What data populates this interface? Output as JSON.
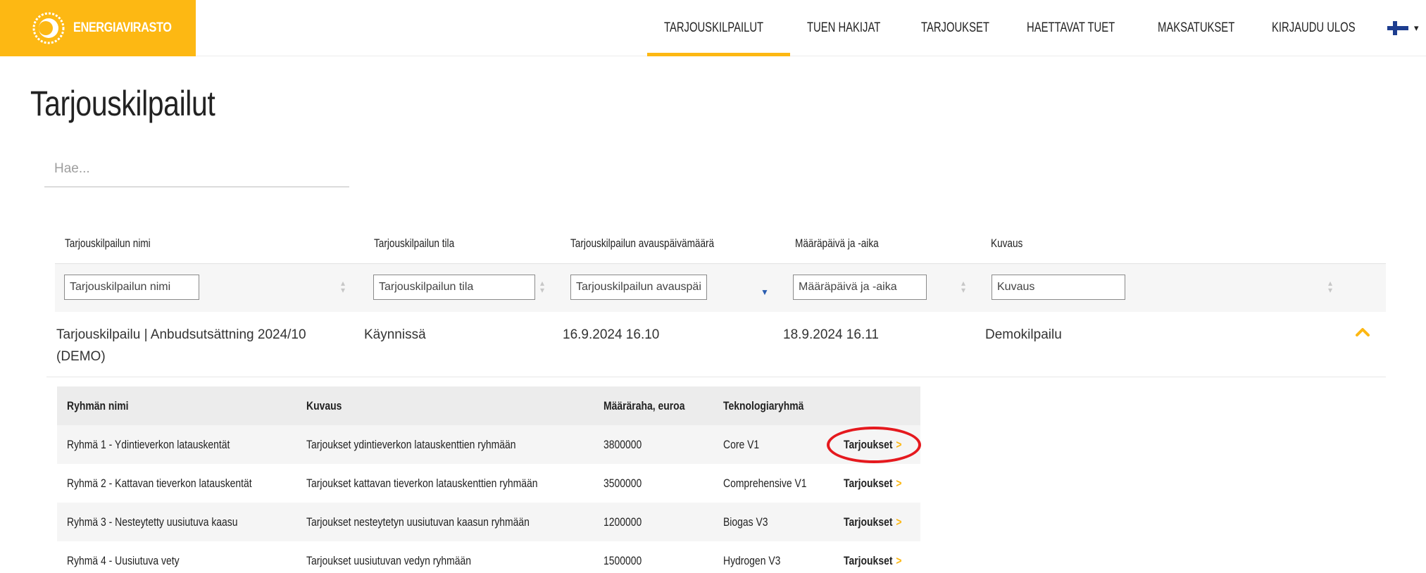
{
  "brand": {
    "name": "ENERGIAVIRASTO",
    "color": "#fdb813"
  },
  "nav": {
    "items": [
      "TARJOUSKILPAILUT",
      "TUEN HAKIJAT",
      "TARJOUKSET",
      "HAETTAVAT TUET",
      "MAKSATUKSET",
      "KIRJAUDU ULOS"
    ],
    "active_index": 0,
    "language_icon": "finnish-flag-icon"
  },
  "page": {
    "title": "Tarjouskilpailut",
    "search_placeholder": "Hae..."
  },
  "table": {
    "columns": [
      "Tarjouskilpailun nimi",
      "Tarjouskilpailun tila",
      "Tarjouskilpailun avauspäivämäärä",
      "Määräpäivä ja -aika",
      "Kuvaus"
    ],
    "filters": [
      "Tarjouskilpailun nimi",
      "Tarjouskilpailun tila",
      "Tarjouskilpailun avauspäi",
      "Määräpäivä ja -aika",
      "Kuvaus"
    ],
    "rows": [
      {
        "name": "Tarjouskilpailu | Anbudsutsättning 2024/10 (DEMO)",
        "status": "Käynnissä",
        "opened": "16.9.2024 16.10",
        "deadline": "18.9.2024 16.11",
        "description": "Demokilpailu"
      }
    ]
  },
  "groups": {
    "columns": [
      "Ryhmän nimi",
      "Kuvaus",
      "Määräraha, euroa",
      "Teknologiaryhmä",
      ""
    ],
    "rows": [
      {
        "name": "Ryhmä 1 - Ydintieverkon latauskentät",
        "description": "Tarjoukset ydintieverkon latauskenttien ryhmään",
        "budget": "3800000",
        "tech": "Core V1",
        "link": "Tarjoukset"
      },
      {
        "name": "Ryhmä 2 - Kattavan tieverkon latauskentät",
        "description": "Tarjoukset kattavan tieverkon latauskenttien ryhmään",
        "budget": "3500000",
        "tech": "Comprehensive V1",
        "link": "Tarjoukset"
      },
      {
        "name": "Ryhmä 3 - Nesteytetty uusiutuva kaasu",
        "description": "Tarjoukset nesteytetyn uusiutuvan kaasun ryhmään",
        "budget": "1200000",
        "tech": "Biogas V3",
        "link": "Tarjoukset"
      },
      {
        "name": "Ryhmä 4 - Uusiutuva vety",
        "description": "Tarjoukset uusiutuvan vedyn ryhmään",
        "budget": "1500000",
        "tech": "Hydrogen V3",
        "link": "Tarjoukset"
      }
    ],
    "highlighted_row": 0,
    "highlight_color": "#e5191e"
  }
}
